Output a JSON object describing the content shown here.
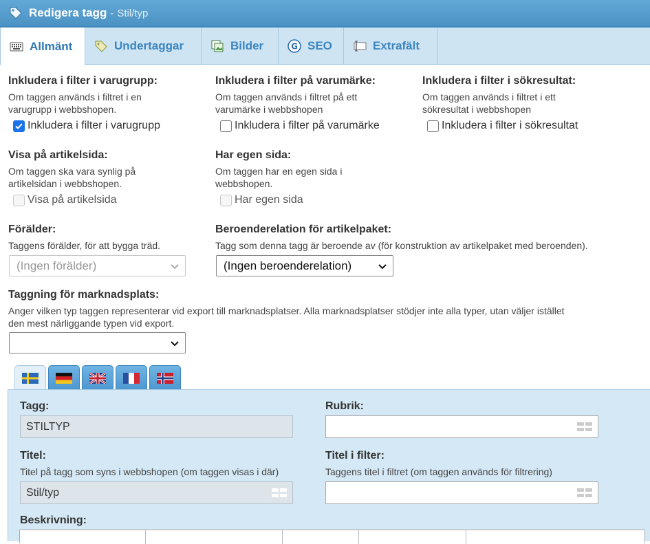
{
  "titlebar": {
    "title": "Redigera tagg",
    "separator": "-",
    "subtitle": "Stil/typ",
    "icon": "tag-icon"
  },
  "tabs": [
    {
      "label": "Allmänt",
      "icon": "keyboard-icon",
      "active": true
    },
    {
      "label": "Undertaggar",
      "icon": "tag-icon"
    },
    {
      "label": "Bilder",
      "icon": "images-icon"
    },
    {
      "label": "SEO",
      "icon": "seo-g-icon"
    },
    {
      "label": "Extrafält",
      "icon": "field-icon"
    }
  ],
  "filter_group": {
    "title": "Inkludera i filter i varugrupp:",
    "desc": "Om taggen används i filtret i en varugrupp i webbshopen.",
    "checkbox_label": "Inkludera i filter i varugrupp",
    "checked": true
  },
  "filter_brand": {
    "title": "Inkludera i filter på varumärke:",
    "desc": "Om taggen används i filtret på ett varumärke i webbshopen",
    "checkbox_label": "Inkludera i filter på varumärke",
    "checked": false
  },
  "filter_search": {
    "title": "Inkludera i filter i sökresultat:",
    "desc": "Om taggen används i filtret i ett sökresultat i webbshopen",
    "checkbox_label": "Inkludera i filter i sökresultat",
    "checked": false
  },
  "show_article": {
    "title": "Visa på artikelsida:",
    "desc": "Om taggen ska vara synlig på artikelsidan i webbshopen.",
    "checkbox_label": "Visa på artikelsida"
  },
  "own_page": {
    "title": "Har egen sida:",
    "desc": "Om taggen har en egen sida i webbshopen.",
    "checkbox_label": "Har egen sida"
  },
  "parent": {
    "title": "Förälder:",
    "desc": "Taggens förälder, för att bygga träd.",
    "value": "(Ingen förälder)"
  },
  "dependency": {
    "title": "Beroenderelation för artikelpaket:",
    "desc": "Tagg som denna tagg är beroende av (för konstruktion av artikelpaket med beroenden).",
    "value": "(Ingen beroenderelation)"
  },
  "marketplace": {
    "title": "Taggning för marknadsplats:",
    "desc_line1": "Anger vilken typ taggen representerar vid export till marknadsplatser. Alla marknadsplatser stödjer inte alla typer, utan väljer istället",
    "desc_line2": "den mest närliggande typen vid export.",
    "value": ""
  },
  "language_tabs": [
    {
      "name": "sv",
      "icon": "flag-sweden-icon",
      "active": true
    },
    {
      "name": "de",
      "icon": "flag-germany-icon"
    },
    {
      "name": "en",
      "icon": "flag-uk-icon"
    },
    {
      "name": "fr",
      "icon": "flag-france-icon"
    },
    {
      "name": "no",
      "icon": "flag-norway-icon"
    }
  ],
  "lang_fields": {
    "tag_label": "Tagg:",
    "tag_value": "STILTYP",
    "heading_label": "Rubrik:",
    "heading_value": "",
    "title_label": "Titel:",
    "title_desc": "Titel på tagg som syns i webbshopen (om taggen visas i där)",
    "title_value": "Stil/typ",
    "filter_title_label": "Titel i filter:",
    "filter_title_desc": "Taggens titel i filtret (om taggen används för filtrering)",
    "filter_title_value": "",
    "description_label": "Beskrivning:"
  },
  "colors": {
    "header": "#4b92c4",
    "tabbar": "#cfe4f3",
    "panel": "#d5e8f5",
    "checkbox_checked": "#1a73e8"
  }
}
